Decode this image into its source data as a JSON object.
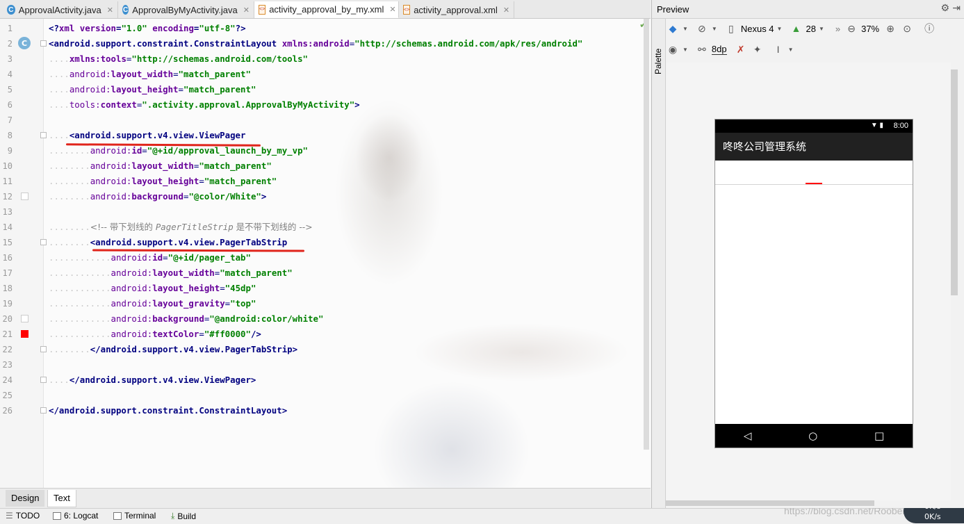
{
  "tabs": [
    {
      "label": "ApprovalActivity.java",
      "icon": "java-class-icon",
      "active": false
    },
    {
      "label": "ApprovalByMyActivity.java",
      "icon": "java-class-icon",
      "active": false
    },
    {
      "label": "activity_approval_by_my.xml",
      "icon": "xml-file-icon",
      "active": true
    },
    {
      "label": "activity_approval.xml",
      "icon": "xml-file-icon",
      "active": false
    }
  ],
  "editor": {
    "line_numbers": [
      "1",
      "2",
      "3",
      "4",
      "5",
      "6",
      "7",
      "8",
      "9",
      "10",
      "11",
      "12",
      "13",
      "14",
      "15",
      "16",
      "17",
      "18",
      "19",
      "20",
      "21",
      "22",
      "23",
      "24",
      "25",
      "26"
    ],
    "gutter_badge": "C",
    "highlight_color": "#e0241b"
  },
  "editor_tabs": {
    "design": "Design",
    "text": "Text"
  },
  "tool_windows": {
    "todo": "TODO",
    "logcat": "6: Logcat",
    "terminal": "Terminal",
    "build": "Build"
  },
  "watermark": "https://blog.csdn.net/Roobert_Chao",
  "speed": {
    "up": "0K/s",
    "down": "0K/s"
  },
  "preview": {
    "title": "Preview",
    "palette_label": "Palette",
    "device": "Nexus 4",
    "api": "28",
    "zoom": "37%",
    "margin": "8dp"
  },
  "phone": {
    "time": "8:00",
    "app_title": "咚咚公司管理系统",
    "tab_indicator_color": "#ff0000"
  }
}
